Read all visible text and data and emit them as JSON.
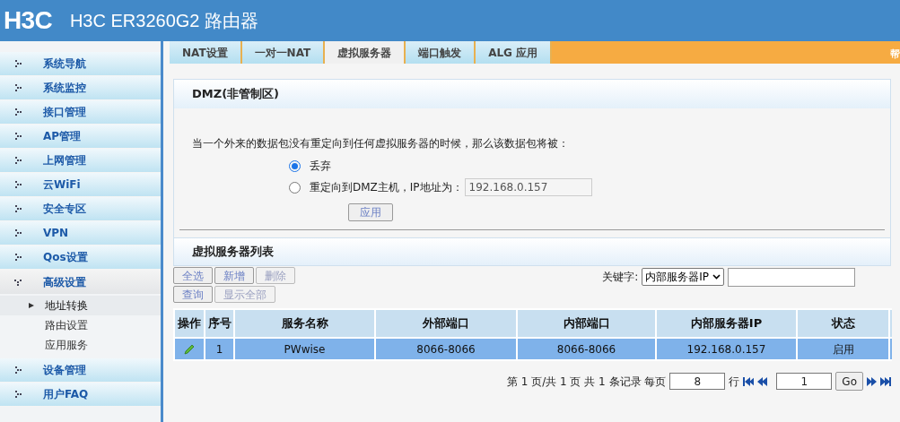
{
  "header": {
    "logo": "H3C",
    "title": "H3C ER3260G2 路由器"
  },
  "sidebar": {
    "items": [
      {
        "label": "系统导航",
        "expanded": false
      },
      {
        "label": "系统监控",
        "expanded": false
      },
      {
        "label": "接口管理",
        "expanded": false
      },
      {
        "label": "AP管理",
        "expanded": false
      },
      {
        "label": "上网管理",
        "expanded": false
      },
      {
        "label": "云WiFi",
        "expanded": false
      },
      {
        "label": "安全专区",
        "expanded": false
      },
      {
        "label": "VPN",
        "expanded": false
      },
      {
        "label": "Qos设置",
        "expanded": false
      },
      {
        "label": "高级设置",
        "expanded": true,
        "children": [
          {
            "label": "地址转换",
            "selected": true
          },
          {
            "label": "路由设置",
            "selected": false
          },
          {
            "label": "应用服务",
            "selected": false
          }
        ]
      },
      {
        "label": "设备管理",
        "expanded": false
      },
      {
        "label": "用户FAQ",
        "expanded": false
      }
    ]
  },
  "tabs": [
    {
      "label": "NAT设置",
      "selected": false
    },
    {
      "label": "一对一NAT",
      "selected": false
    },
    {
      "label": "虚拟服务器",
      "selected": true
    },
    {
      "label": "端口触发",
      "selected": false
    },
    {
      "label": "ALG 应用",
      "selected": false
    }
  ],
  "help": "帮",
  "dmz": {
    "title": "DMZ(非管制区)",
    "description": "当一个外来的数据包没有重定向到任何虚拟服务器的时候，那么该数据包将被：",
    "options": [
      {
        "label": "丢弃",
        "selected": true
      },
      {
        "label": "重定向到DMZ主机，IP地址为：",
        "selected": false,
        "value": "192.168.0.157"
      }
    ],
    "apply": "应用"
  },
  "list": {
    "title": "虚拟服务器列表",
    "buttons": [
      {
        "label": "全选",
        "disabled": false
      },
      {
        "label": "新增",
        "disabled": false
      },
      {
        "label": "删除",
        "disabled": true
      },
      {
        "label": "查询",
        "disabled": false
      },
      {
        "label": "显示全部",
        "disabled": true
      }
    ],
    "keyword_label": "关键字:",
    "keyword_select": "内部服务器IP",
    "action_column": "操作",
    "columns": [
      "序号",
      "服务名称",
      "外部端口",
      "内部端口",
      "内部服务器IP",
      "状态"
    ],
    "rows": [
      {
        "selected": true,
        "cells": [
          "1",
          "PWwise",
          "8066-8066",
          "8066-8066",
          "192.168.0.157",
          "启用"
        ]
      }
    ],
    "pagination": {
      "summary": "第 1 页/共 1 页 共 1 条记录 每页",
      "per_page": "8",
      "rows_label": "行",
      "page": "1",
      "go": "Go"
    }
  }
}
